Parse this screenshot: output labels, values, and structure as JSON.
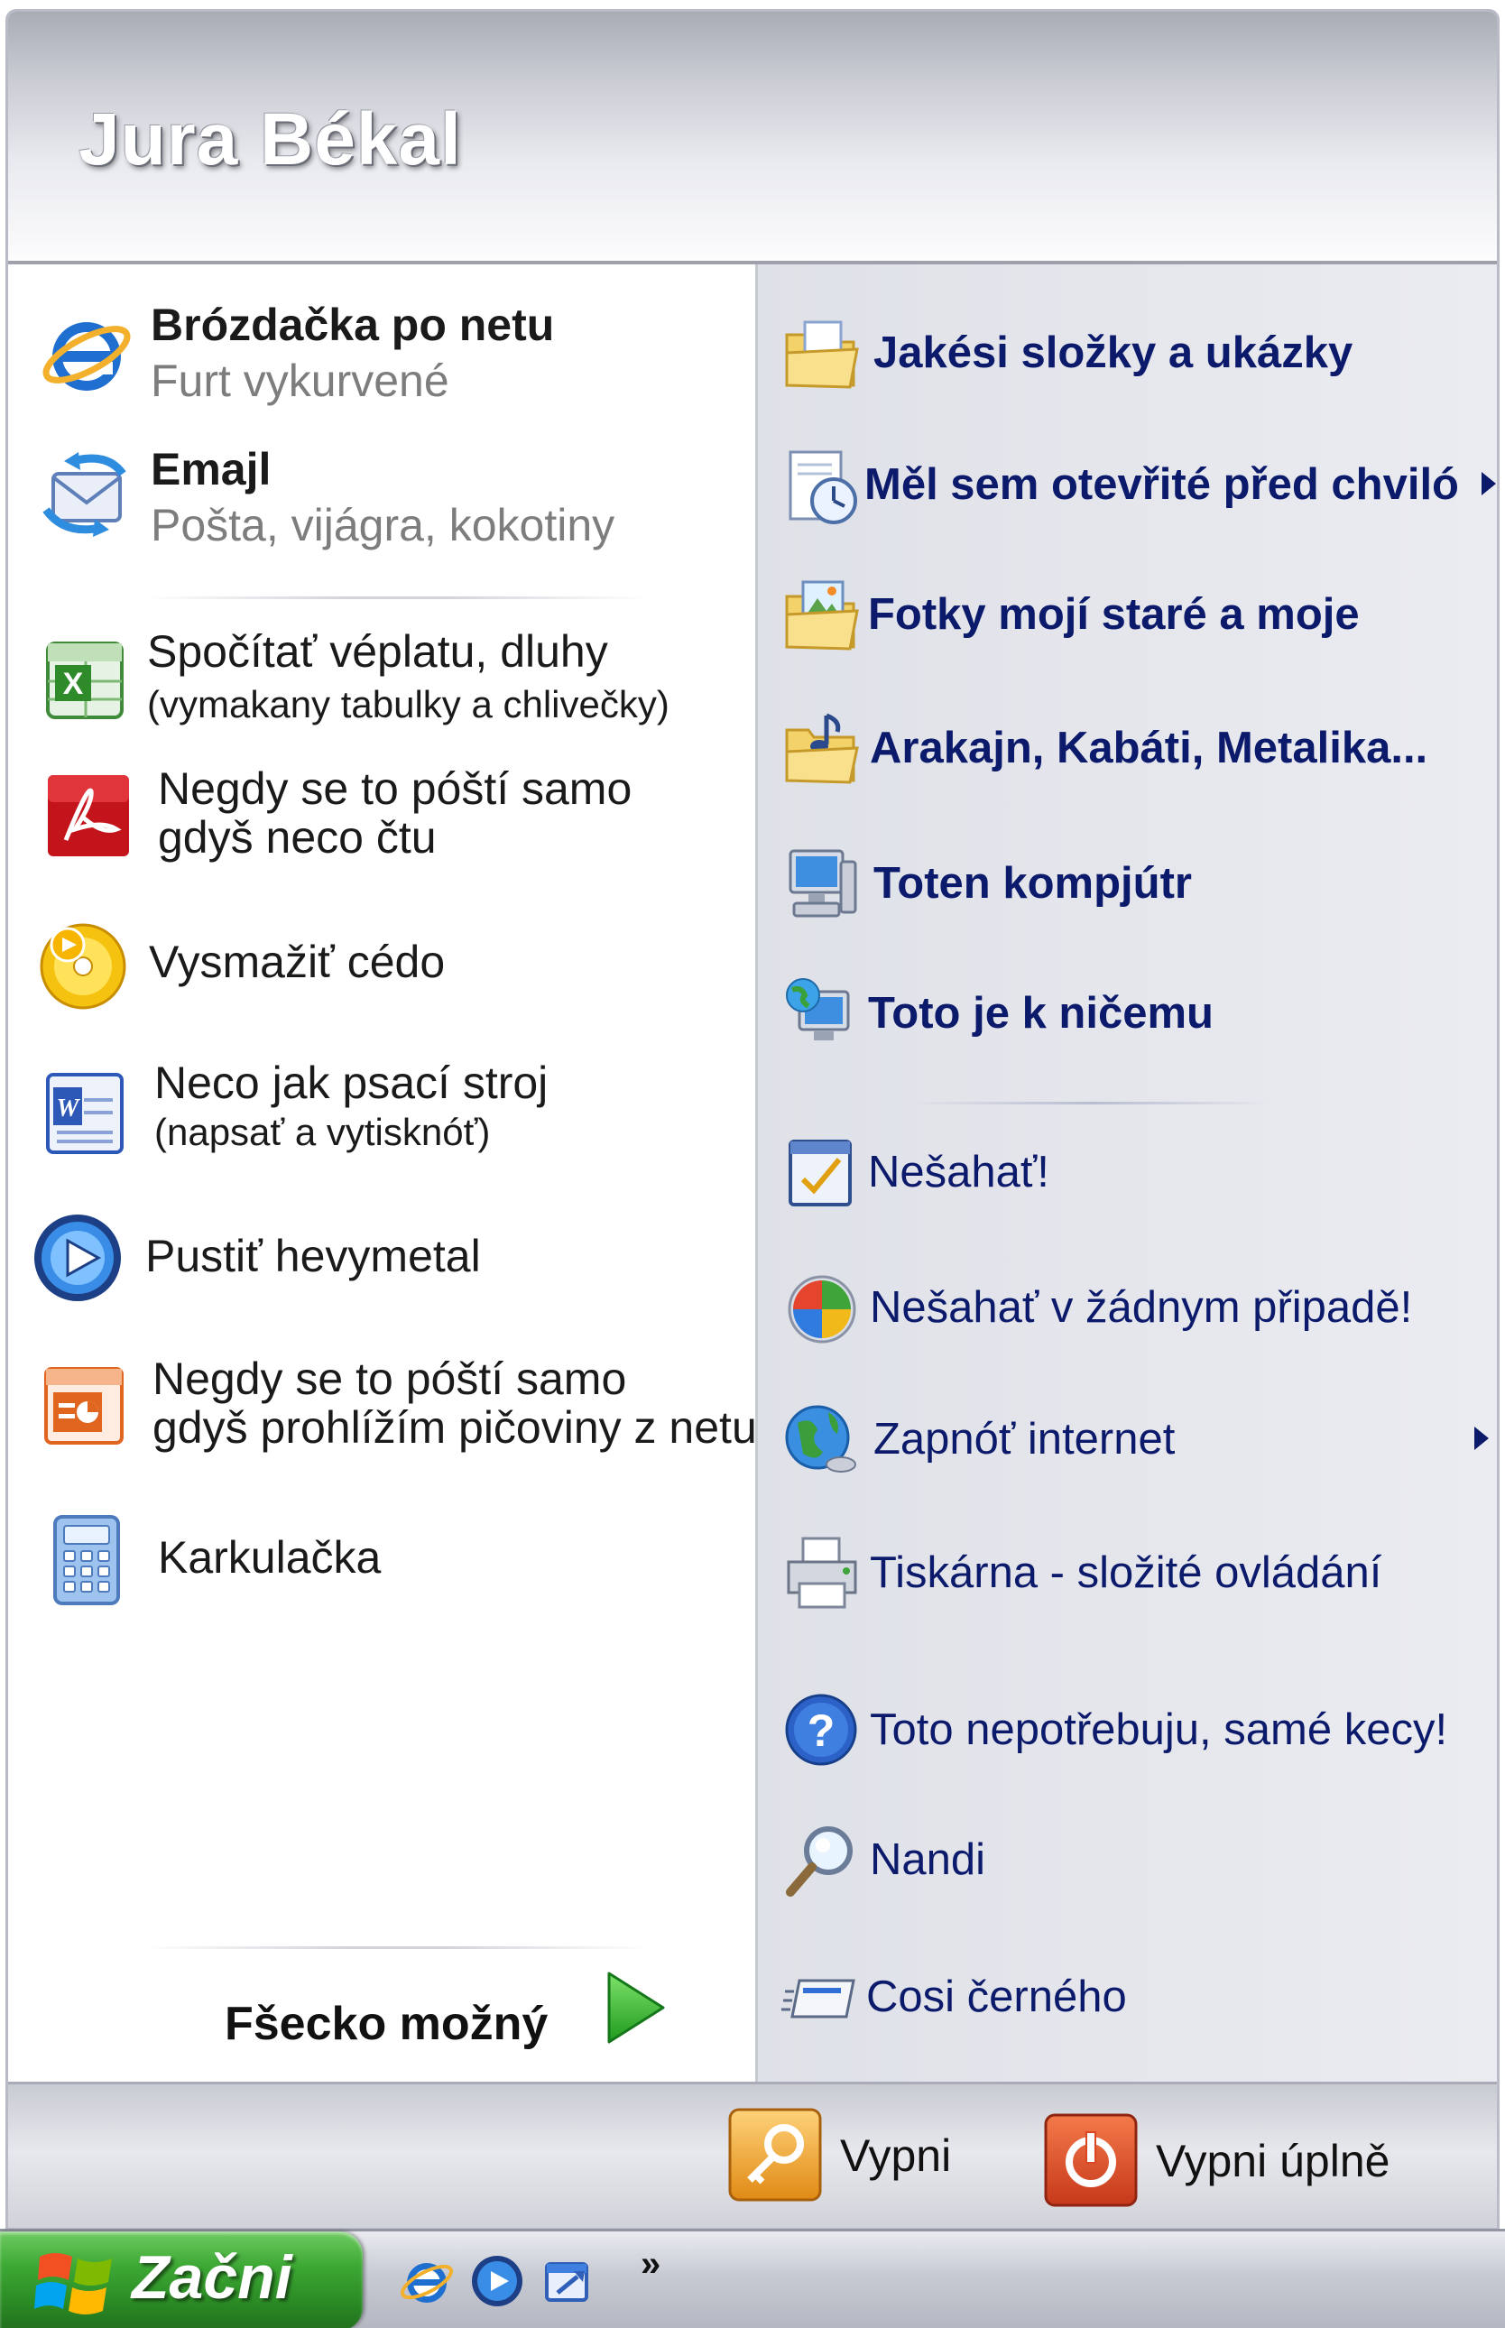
{
  "user": {
    "name": "Jura Békal"
  },
  "pinned": [
    {
      "title": "Brózdačka po netu",
      "subtitle": "Furt vykurvené",
      "icon": "internet-explorer-icon"
    },
    {
      "title": "Emajl",
      "subtitle": "Pošta, vijágra, kokotiny",
      "icon": "outlook-express-icon"
    }
  ],
  "recent": [
    {
      "line1": "Spočítať véplatu, dluhy",
      "line2": "(vymakany tabulky a chlivečky)",
      "icon": "excel-icon"
    },
    {
      "line1": "Negdy se to póští samo",
      "line2": "gdyš neco čtu",
      "icon": "acrobat-reader-icon"
    },
    {
      "line1": "Vysmažiť cédo",
      "line2": "",
      "icon": "cd-burner-icon"
    },
    {
      "line1": "Neco jak psací stroj",
      "line2": "(napsať a vytisknóť)",
      "icon": "word-icon"
    },
    {
      "line1": "Pustiť hevymetal",
      "line2": "",
      "icon": "media-player-icon"
    },
    {
      "line1": "Negdy se to póští samo",
      "line2": "gdyš prohlížím pičoviny z netu",
      "icon": "powerpoint-icon"
    },
    {
      "line1": "Karkulačka",
      "line2": "",
      "icon": "calculator-icon"
    }
  ],
  "all_programs": {
    "label": "Fšecko možný"
  },
  "places": [
    {
      "label": "Jakési složky a ukázky",
      "bold": true,
      "icon": "documents-folder-icon",
      "arrow": false
    },
    {
      "label": "Měl sem otevřité před chviló",
      "bold": true,
      "icon": "recent-documents-icon",
      "arrow": true
    },
    {
      "label": "Fotky mojí staré a moje",
      "bold": true,
      "icon": "pictures-folder-icon",
      "arrow": false
    },
    {
      "label": "Arakajn, Kabáti, Metalika...",
      "bold": true,
      "icon": "music-folder-icon",
      "arrow": false
    },
    {
      "label": "Toten kompjútr",
      "bold": true,
      "icon": "my-computer-icon",
      "arrow": false
    },
    {
      "label": "Toto je k ničemu",
      "bold": true,
      "icon": "network-places-icon",
      "arrow": false
    },
    {
      "label": "Nešahať!",
      "bold": false,
      "icon": "control-panel-icon",
      "arrow": false
    },
    {
      "label": "Nešahať v žádnym připadě!",
      "bold": false,
      "icon": "windows-security-icon",
      "arrow": false
    },
    {
      "label": "Zapnóť internet",
      "bold": false,
      "icon": "connect-to-icon",
      "arrow": true
    },
    {
      "label": "Tiskárna - složité ovládání",
      "bold": false,
      "icon": "printers-icon",
      "arrow": false
    },
    {
      "label": "Toto nepotřebuju, samé kecy!",
      "bold": false,
      "icon": "help-icon",
      "arrow": false
    },
    {
      "label": "Nandi",
      "bold": false,
      "icon": "search-icon",
      "arrow": false
    },
    {
      "label": "Cosi černého",
      "bold": false,
      "icon": "run-icon",
      "arrow": false
    }
  ],
  "footer": {
    "logoff_label": "Vypni",
    "shutdown_label": "Vypni úplně"
  },
  "taskbar": {
    "start_label": "Začni",
    "overflow": "»"
  },
  "colors": {
    "start_green": "#3da834",
    "link_blue": "#0c1a6b",
    "header_gray": "#c8cad2"
  }
}
